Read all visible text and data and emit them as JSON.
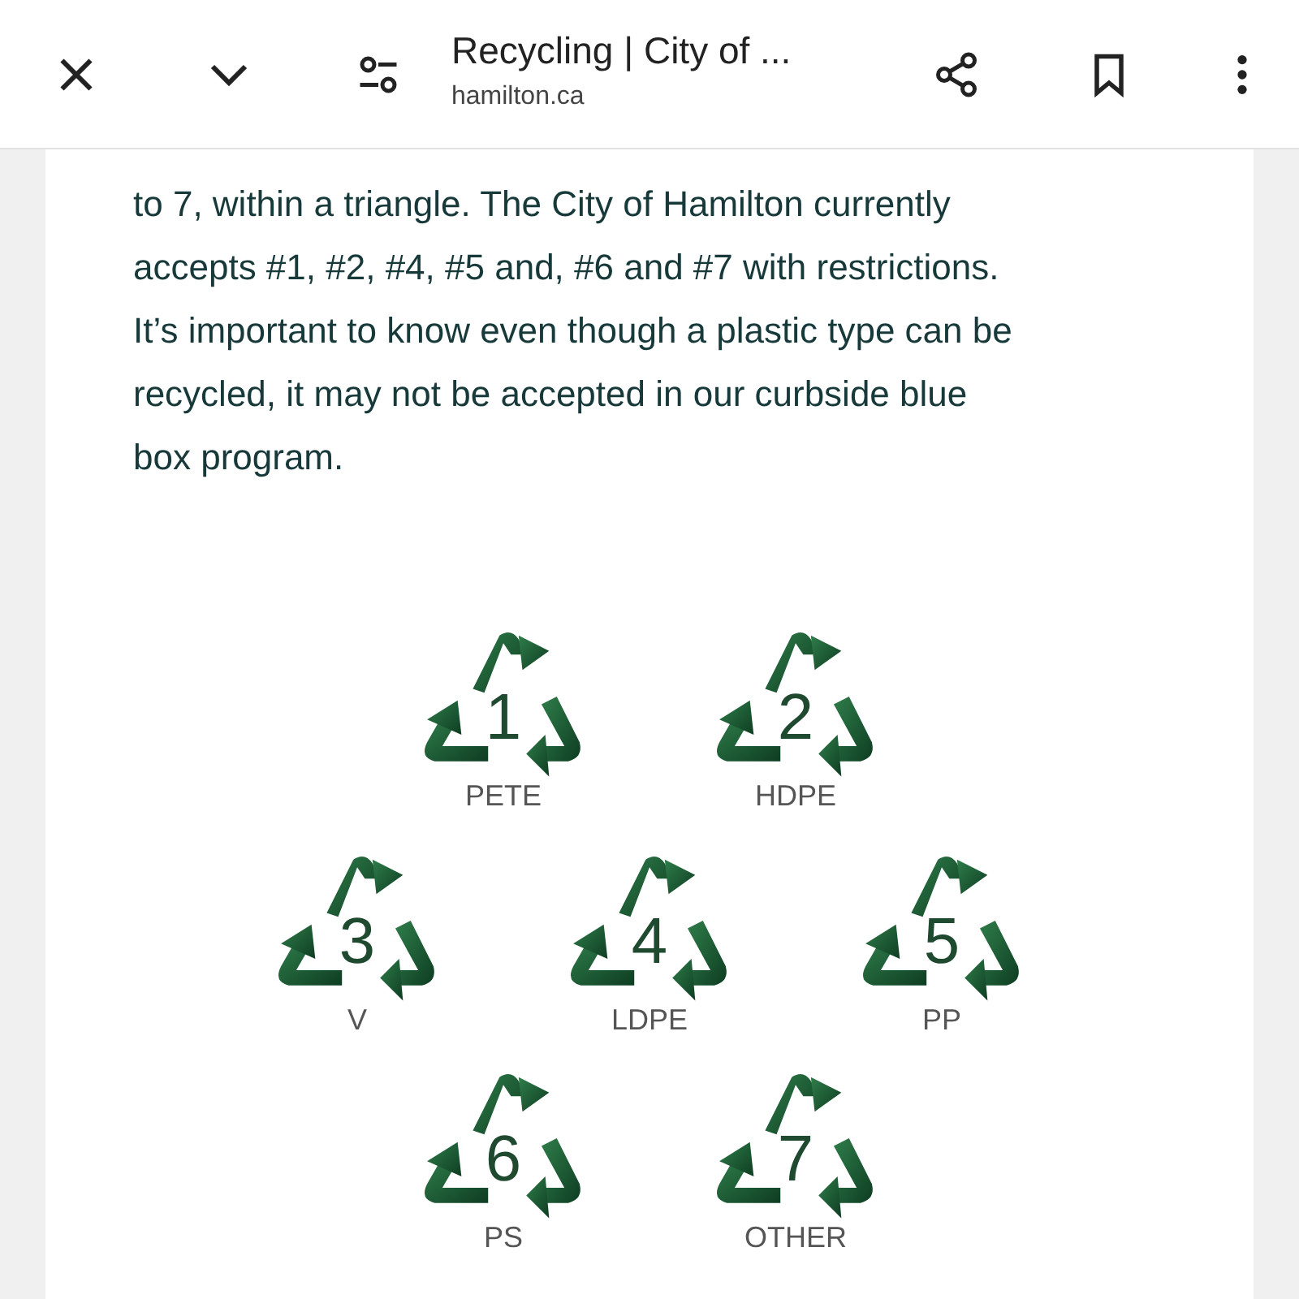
{
  "browser_bar": {
    "title": "Recycling | City of ...",
    "domain": "hamilton.ca"
  },
  "article": {
    "paragraph": "to 7, within a triangle. The City of Hamilton currently accepts #1, #2, #4, #5 and, #6 and #7 with restrictions. It’s important to know even though a plastic type can be recycled, it may not be accepted in our curbside blue box program."
  },
  "symbol_rows": [
    {
      "symbols": [
        {
          "number": "1",
          "label": "PETE"
        },
        {
          "number": "2",
          "label": "HDPE"
        }
      ]
    },
    {
      "symbols": [
        {
          "number": "3",
          "label": "V"
        },
        {
          "number": "4",
          "label": "LDPE"
        },
        {
          "number": "5",
          "label": "PP"
        }
      ]
    },
    {
      "symbols": [
        {
          "number": "6",
          "label": "PS"
        },
        {
          "number": "7",
          "label": "OTHER"
        }
      ]
    }
  ]
}
